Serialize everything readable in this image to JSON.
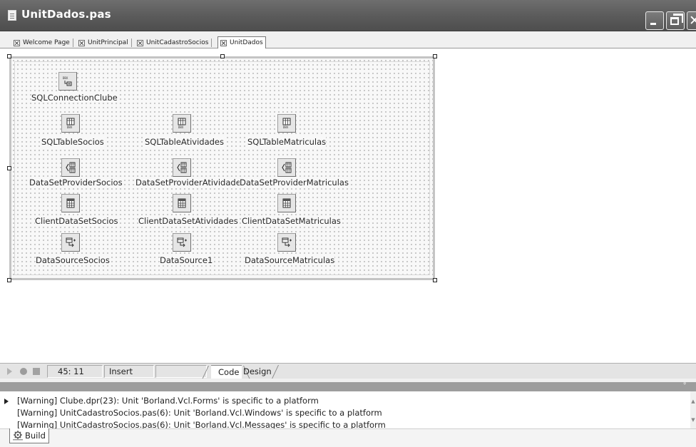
{
  "window": {
    "title": "UnitDados.pas",
    "icons": {
      "file": "document-icon",
      "minimize": "minimize-icon",
      "maximize": "restore-icon",
      "close": "close-icon"
    }
  },
  "tabs": [
    {
      "label": "Welcome Page",
      "active": false
    },
    {
      "label": "UnitPrincipal",
      "active": false
    },
    {
      "label": "UnitCadastroSocios",
      "active": false
    },
    {
      "label": "UnitDados",
      "active": true
    }
  ],
  "form": {
    "components": [
      {
        "label": "SQLConnectionClube",
        "icon": "sqlconnection-icon"
      },
      {
        "label": "SQLTableSocios",
        "icon": "sqltable-icon"
      },
      {
        "label": "SQLTableAtividades",
        "icon": "sqltable-icon"
      },
      {
        "label": "SQLTableMatriculas",
        "icon": "sqltable-icon"
      },
      {
        "label": "DataSetProviderSocios",
        "icon": "datasetprovider-icon"
      },
      {
        "label": "DataSetProviderAtividades",
        "icon": "datasetprovider-icon"
      },
      {
        "label": "DataSetProviderMatriculas",
        "icon": "datasetprovider-icon"
      },
      {
        "label": "ClientDataSetSocios",
        "icon": "clientdataset-icon"
      },
      {
        "label": "ClientDataSetAtividades",
        "icon": "clientdataset-icon"
      },
      {
        "label": "ClientDataSetMatriculas",
        "icon": "clientdataset-icon"
      },
      {
        "label": "DataSourceSocios",
        "icon": "datasource-icon"
      },
      {
        "label": "DataSource1",
        "icon": "datasource-icon"
      },
      {
        "label": "DataSourceMatriculas",
        "icon": "datasource-icon"
      }
    ]
  },
  "statusbar": {
    "position": "45: 11",
    "mode": "Insert",
    "tab_code": "Code",
    "tab_design": "Design"
  },
  "messages": [
    "[Warning] Clube.dpr(23): Unit 'Borland.Vcl.Forms' is specific to a platform",
    "[Warning] UnitCadastroSocios.pas(6): Unit 'Borland.Vcl.Windows' is specific to a platform",
    "[Warning] UnitCadastroSocios.pas(6): Unit 'Borland.Vcl.Messages' is specific to a platform"
  ],
  "bottom_tab": {
    "label": "Build",
    "icon": "build-icon"
  }
}
